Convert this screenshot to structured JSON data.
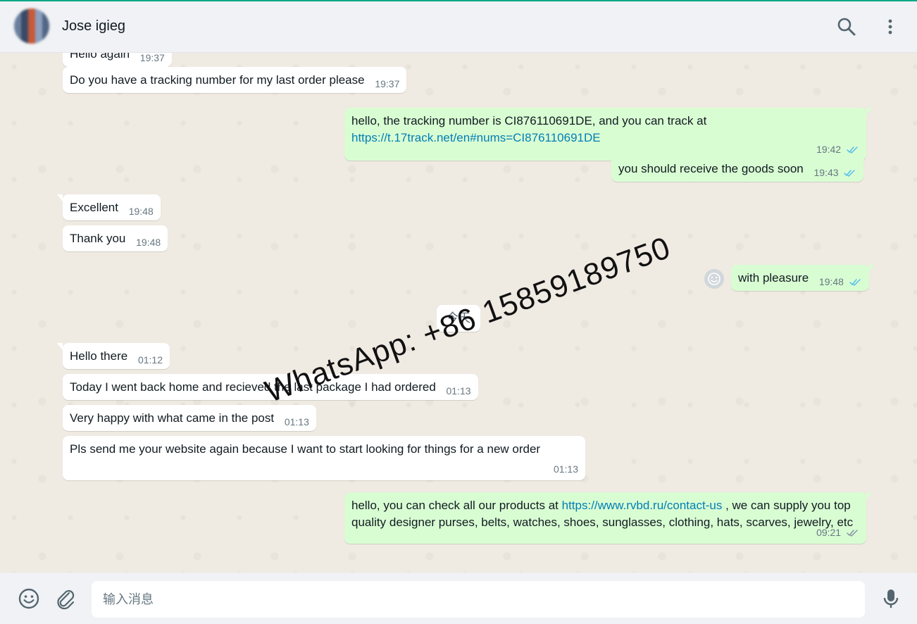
{
  "header": {
    "contact_name": "Jose    igieg"
  },
  "messages": [
    {
      "dir": "in",
      "text": "Hello again",
      "time": "19:37"
    },
    {
      "dir": "in",
      "text": "Do you have a tracking number for my last order please",
      "time": "19:37"
    },
    {
      "dir": "out",
      "text": "hello, the tracking number is CI876110691DE, and you can track at",
      "link": "https://t.17track.net/en#nums=CI876110691DE",
      "time": "19:42"
    },
    {
      "dir": "out",
      "text": "you should receive the goods soon",
      "time": "19:43"
    },
    {
      "dir": "in",
      "text": "Excellent",
      "time": "19:48"
    },
    {
      "dir": "in",
      "text": "Thank you",
      "time": "19:48"
    },
    {
      "dir": "out",
      "text": "with pleasure",
      "time": "19:48"
    },
    {
      "dir": "in",
      "text": "Hello there",
      "time": "01:12"
    },
    {
      "dir": "in",
      "text": "Today I went back home and recieved the last package I had ordered",
      "time": "01:13"
    },
    {
      "dir": "in",
      "text": "Very happy with what came in the post",
      "time": "01:13"
    },
    {
      "dir": "in",
      "text": "Pls send me your website again because I want to start looking for things for a new order",
      "time": "01:13"
    },
    {
      "dir": "out",
      "text_before": "hello, you can check all our products at",
      "link": "https://www.rvbd.ru/contact-us",
      "text_after": ", we can supply you top quality designer purses, belts, watches, shoes, sunglasses, clothing, hats, scarves, jewelry, etc",
      "time": "09:21"
    }
  ],
  "day_separator": "今天",
  "watermark": "WhatsApp: +86 15859189750",
  "composer": {
    "placeholder": "输入消息"
  },
  "colors": {
    "accent": "#00a884",
    "outgoing_bubble": "#d9fdd3",
    "incoming_bubble": "#ffffff",
    "chat_background": "#efeae2",
    "read_ticks": "#53bdeb",
    "link": "#027eb5"
  },
  "icons": {
    "header": [
      "search-icon",
      "menu-icon"
    ],
    "footer": [
      "emoji-icon",
      "attach-icon",
      "mic-icon"
    ]
  }
}
